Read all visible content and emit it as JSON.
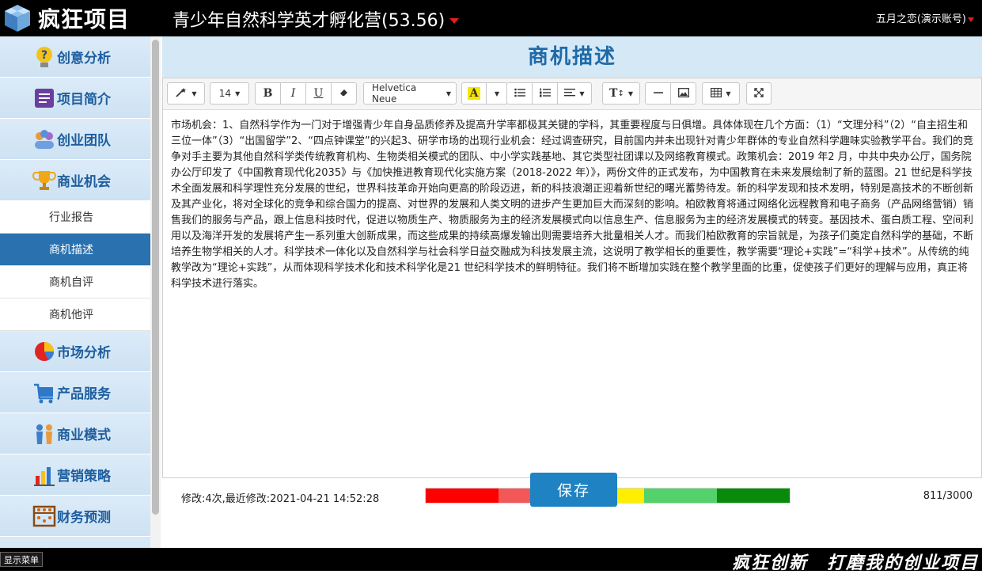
{
  "app": {
    "logo_text": "疯狂项目",
    "project_title": "青少年自然科学英才孵化营(53.56)",
    "user_label": "五月之恋(演示账号)"
  },
  "sidebar": {
    "items": [
      {
        "label": "创意分析",
        "icon": "lightbulb-question-icon"
      },
      {
        "label": "项目简介",
        "icon": "document-icon"
      },
      {
        "label": "创业团队",
        "icon": "team-icon"
      },
      {
        "label": "商业机会",
        "icon": "trophy-icon"
      }
    ],
    "sub_items": [
      {
        "label": "行业报告",
        "active": false
      },
      {
        "label": "商机描述",
        "active": true
      },
      {
        "label": "商机自评",
        "active": false
      },
      {
        "label": "商机他评",
        "active": false
      }
    ],
    "items_after": [
      {
        "label": "市场分析",
        "icon": "pie-chart-icon"
      },
      {
        "label": "产品服务",
        "icon": "cart-icon"
      },
      {
        "label": "商业模式",
        "icon": "people-model-icon"
      },
      {
        "label": "营销策略",
        "icon": "bar-chart-icon"
      },
      {
        "label": "财务预测",
        "icon": "abacus-icon"
      }
    ]
  },
  "page": {
    "title": "商机描述"
  },
  "toolbar": {
    "font_size": "14",
    "font_family": "Helvetica Neue",
    "bold": "B",
    "italic": "I",
    "underline": "U",
    "highlight": "A",
    "text_height": "T"
  },
  "editor": {
    "content": "市场机会：1、自然科学作为一门对于增强青少年自身品质修养及提高升学率都极其关键的学科，其重要程度与日俱增。具体体现在几个方面：（1）“文理分科”（2）“自主招生和三位一体”（3）“出国留学”2、“四点钟课堂”的兴起3、研学市场的出现行业机会：经过调查研究，目前国内并未出现针对青少年群体的专业自然科学趣味实验教学平台。我们的竞争对手主要为其他自然科学类传统教育机构、生物类相关模式的团队、中小学实践基地、其它类型社团课以及网络教育模式。政策机会：2019 年2 月，中共中央办公厅，国务院办公厅印发了《中国教育现代化2035》与《加快推进教育现代化实施方案（2018-2022 年）》，两份文件的正式发布，为中国教育在未来发展绘制了新的蓝图。21 世纪是科学技术全面发展和科学理性充分发展的世纪，世界科技革命开始向更高的阶段迈进，新的科技浪潮正迎着新世纪的曙光蓄势待发。新的科学发现和技术发明，特别是高技术的不断创新及其产业化，将对全球化的竞争和综合国力的提高、对世界的发展和人类文明的进步产生更加巨大而深刻的影响。柏欧教育将通过网络化远程教育和电子商务（产品网络营销）销售我们的服务与产品，跟上信息科技时代，促进以物质生产、物质服务为主的经济发展模式向以信息生产、信息服务为主的经济发展模式的转变。基因技术、蛋白质工程、空间利用以及海洋开发的发展将产生一系列重大创新成果，而这些成果的持续高爆发输出则需要培养大批量相关人才。而我们柏欧教育的宗旨就是，为孩子们奠定自然科学的基础，不断培养生物学相关的人才。科学技术一体化以及自然科学与社会科学日益交融成为科技发展主流，这说明了教学相长的重要性，教学需要“理论+实践”=“科学+技术”。从传统的纯教学改为“理论+实践”，从而体现科学技术化和技术科学化是21 世纪科学技术的鲜明特征。我们将不断增加实践在整个教学里面的比重，促使孩子们更好的理解与应用，真正将科学技术进行落实。"
  },
  "status": {
    "mod_info": "修改:4次,最近修改:2021-04-21 14:52:28",
    "counter": "811/3000",
    "progress_colors": [
      "#ff0000",
      "#f25858",
      "#ffee00",
      "#55d16b",
      "#0a8a0a"
    ]
  },
  "save_label": "保存",
  "bottom": {
    "show_menu": "显示菜单",
    "slogan": "疯狂创新　打磨我的创业项目"
  }
}
